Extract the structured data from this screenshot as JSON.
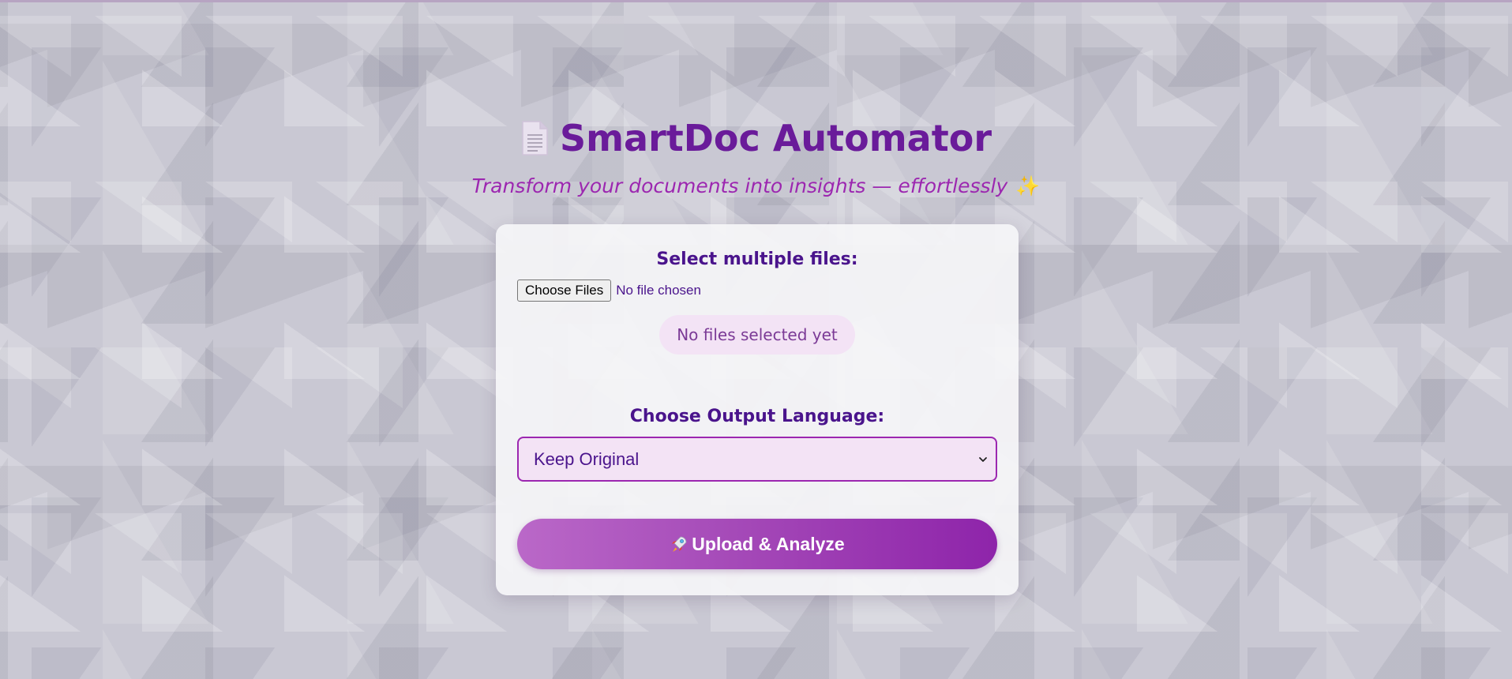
{
  "app": {
    "title": "SmartDoc Automator",
    "subtitle": "Transform your documents into insights — effortlessly",
    "title_icon": "document-icon",
    "subtitle_icon": "sparkles-icon",
    "sparkle_glyph": "✨"
  },
  "files": {
    "label": "Select multiple files:",
    "choose_button": "Choose Files",
    "status_text": "No file chosen",
    "selection_pill": "No files selected yet"
  },
  "language": {
    "label": "Choose Output Language:",
    "selected": "Keep Original"
  },
  "actions": {
    "upload_label": "Upload & Analyze",
    "upload_icon": "rocket-icon"
  },
  "colors": {
    "accent": "#6a1b9a",
    "subtitle": "#9c27b0",
    "label": "#4a148c",
    "button_gradient_start": "#ba68c8",
    "button_gradient_end": "#8e24aa",
    "pill_bg": "#f3e3f5"
  }
}
